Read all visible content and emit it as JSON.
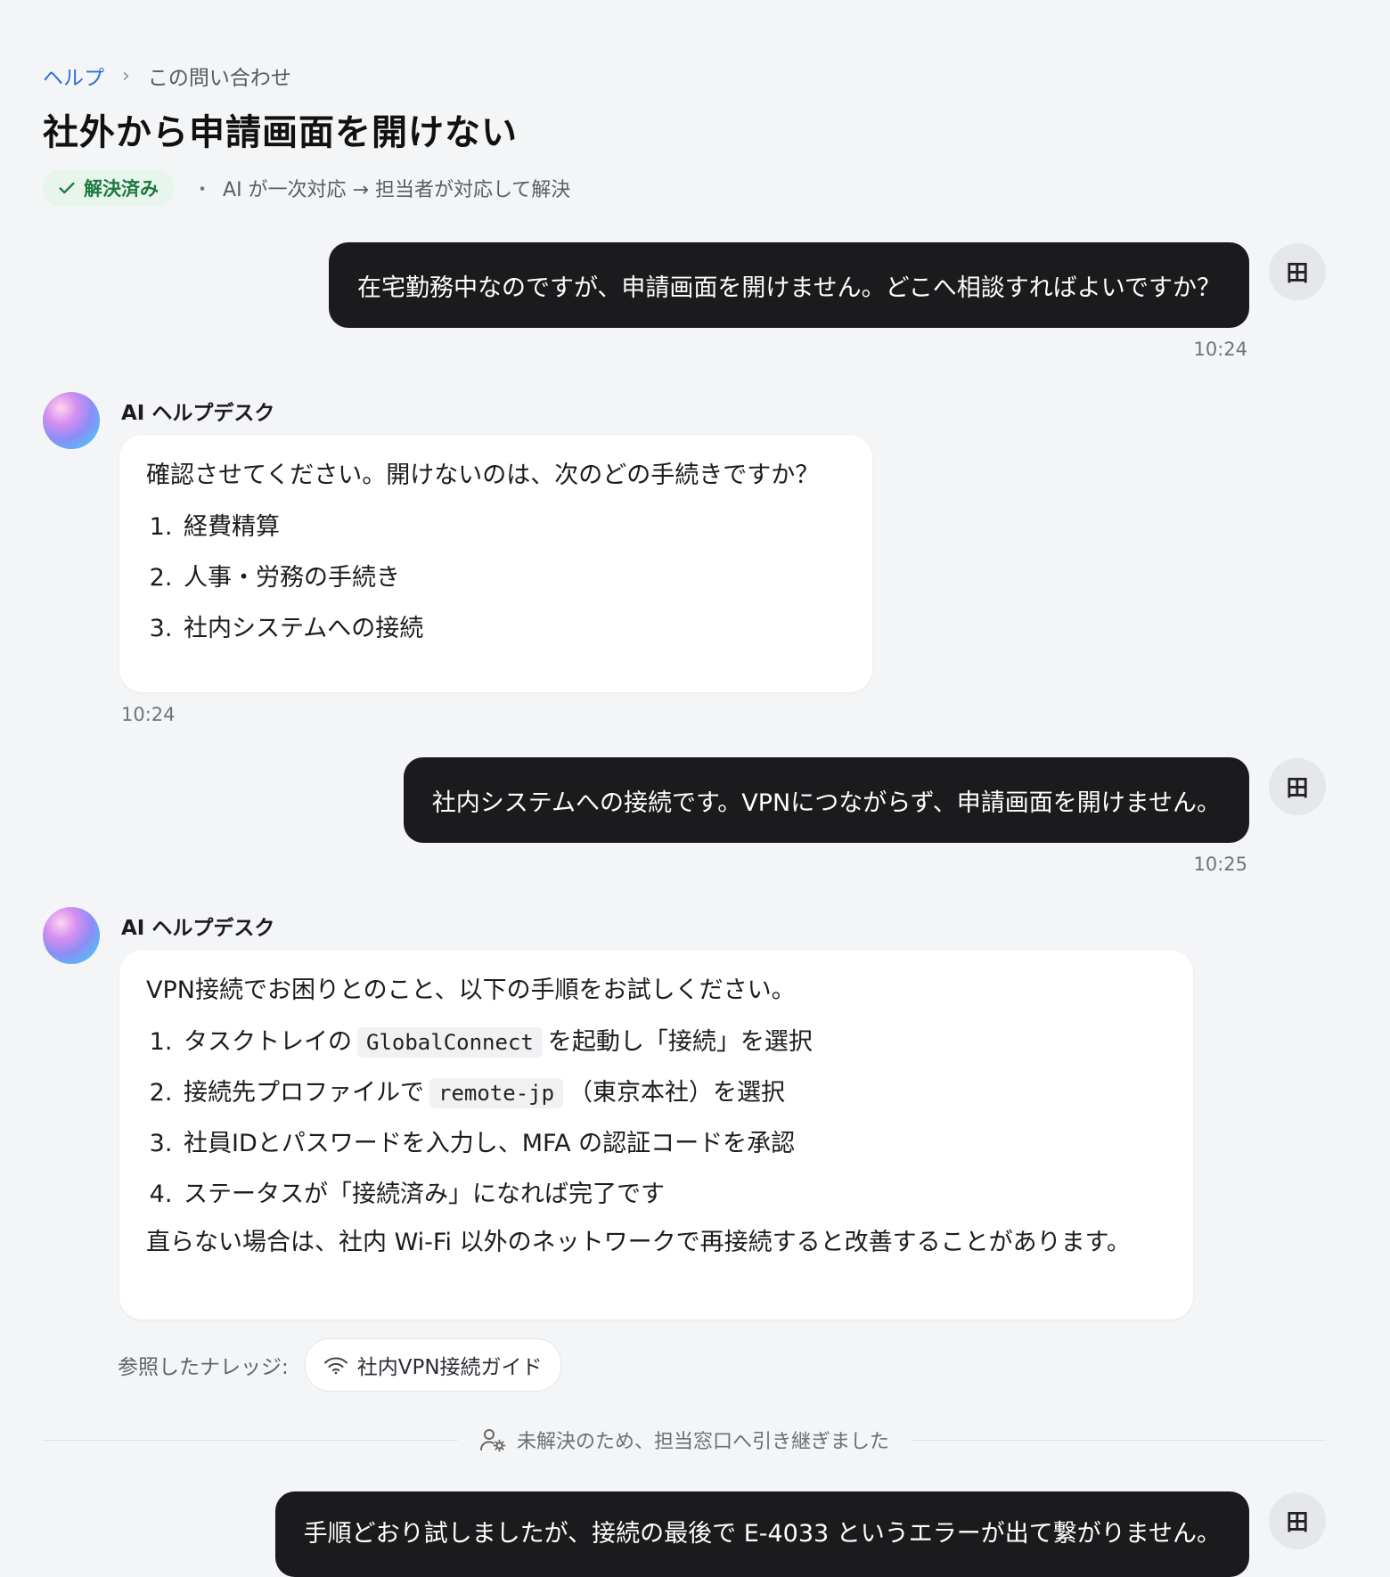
{
  "breadcrumb": {
    "root": "ヘルプ",
    "separator": "›",
    "current": "この問い合わせ"
  },
  "title": "社外から申請画面を開けない",
  "status": {
    "badge": "解決済み",
    "dot": "・",
    "flow": "AI が一次対応 → 担当者が対応して解決"
  },
  "user_avatar_label": "田",
  "ai_name": "AI ヘルプデスク",
  "messages": [
    {
      "role": "user",
      "text": "在宅勤務中なのですが、申請画面を開けません。どこへ相談すればよいですか？",
      "time": "10:24"
    },
    {
      "role": "ai",
      "intro": "確認させてください。開けないのは、次のどの手続きですか？",
      "items": [
        "経費精算",
        "人事・労務の手続き",
        "社内システムへの接続"
      ],
      "time": "10:24"
    },
    {
      "role": "user",
      "text": "社内システムへの接続です。VPNにつながらず、申請画面を開けません。",
      "time": "10:25"
    },
    {
      "role": "ai",
      "intro": "VPN接続でお困りとのこと、以下の手順をお試しください。",
      "steps": [
        {
          "before": "タスクトレイの",
          "code": "GlobalConnect",
          "after": "を起動し「接続」を選択"
        },
        {
          "before": "接続先プロファイルで",
          "code": "remote-jp",
          "after": "（東京本社）を選択"
        },
        {
          "text": "社員IDとパスワードを入力し、MFA の認証コードを承認"
        },
        {
          "text": "ステータスが「接続済み」になれば完了です"
        }
      ],
      "outro": "直らない場合は、社内 Wi-Fi 以外のネットワークで再接続すると改善することがあります。"
    }
  ],
  "knowledge": {
    "label": "参照したナレッジ:",
    "chip": "社内VPN接続ガイド",
    "icon": "wifi-icon"
  },
  "handoff": {
    "text": "未解決のため、担当窓口へ引き継ぎました",
    "icon": "user-gear-icon"
  },
  "last_message": {
    "text": "手順どおり試しましたが、接続の最後で E-4033 というエラーが出て繋がりません。"
  },
  "colors": {
    "accent": "#2f6fd6",
    "resolved": "#1d7a40",
    "user_bubble": "#1b1b1d"
  }
}
